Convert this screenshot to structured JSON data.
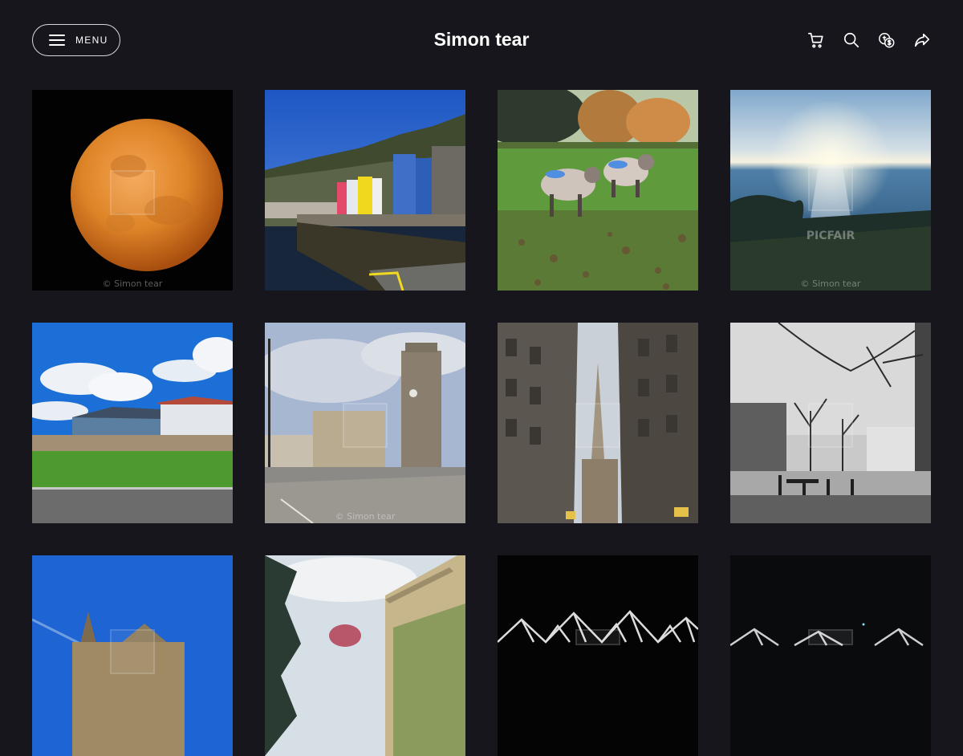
{
  "header": {
    "menu_label": "MENU",
    "site_title": "Simon tear",
    "icons": [
      "cart-icon",
      "search-icon",
      "currency-icon",
      "share-icon"
    ]
  },
  "gallery": {
    "photos": [
      {
        "subject": "orange-moon",
        "watermark": "© Simon tear"
      },
      {
        "subject": "colourful-harbour-houses",
        "watermark": ""
      },
      {
        "subject": "sheep-in-field",
        "watermark": ""
      },
      {
        "subject": "sea-sunset",
        "watermark": "© Simon tear",
        "brand_watermark": "PICFAIR"
      },
      {
        "subject": "house-under-blue-sky",
        "watermark": ""
      },
      {
        "subject": "church-tower-street",
        "watermark": "© Simon tear"
      },
      {
        "subject": "narrow-street-spire",
        "watermark": ""
      },
      {
        "subject": "black-white-square",
        "watermark": ""
      },
      {
        "subject": "church-blue-sky",
        "watermark": ""
      },
      {
        "subject": "building-with-trees",
        "watermark": ""
      },
      {
        "subject": "night-structure-1",
        "watermark": ""
      },
      {
        "subject": "night-structure-2",
        "watermark": ""
      }
    ]
  },
  "colors": {
    "background": "#18161d",
    "text": "#ffffff"
  }
}
